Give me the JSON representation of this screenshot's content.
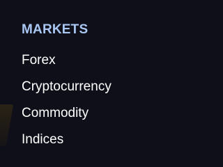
{
  "markets": {
    "heading": "MARKETS",
    "items": [
      {
        "label": "Forex"
      },
      {
        "label": "Cryptocurrency"
      },
      {
        "label": "Commodity"
      },
      {
        "label": "Indices"
      }
    ]
  },
  "colors": {
    "background": "#0f0f1a",
    "heading": "#a9c7f2",
    "link": "#ffffff"
  }
}
